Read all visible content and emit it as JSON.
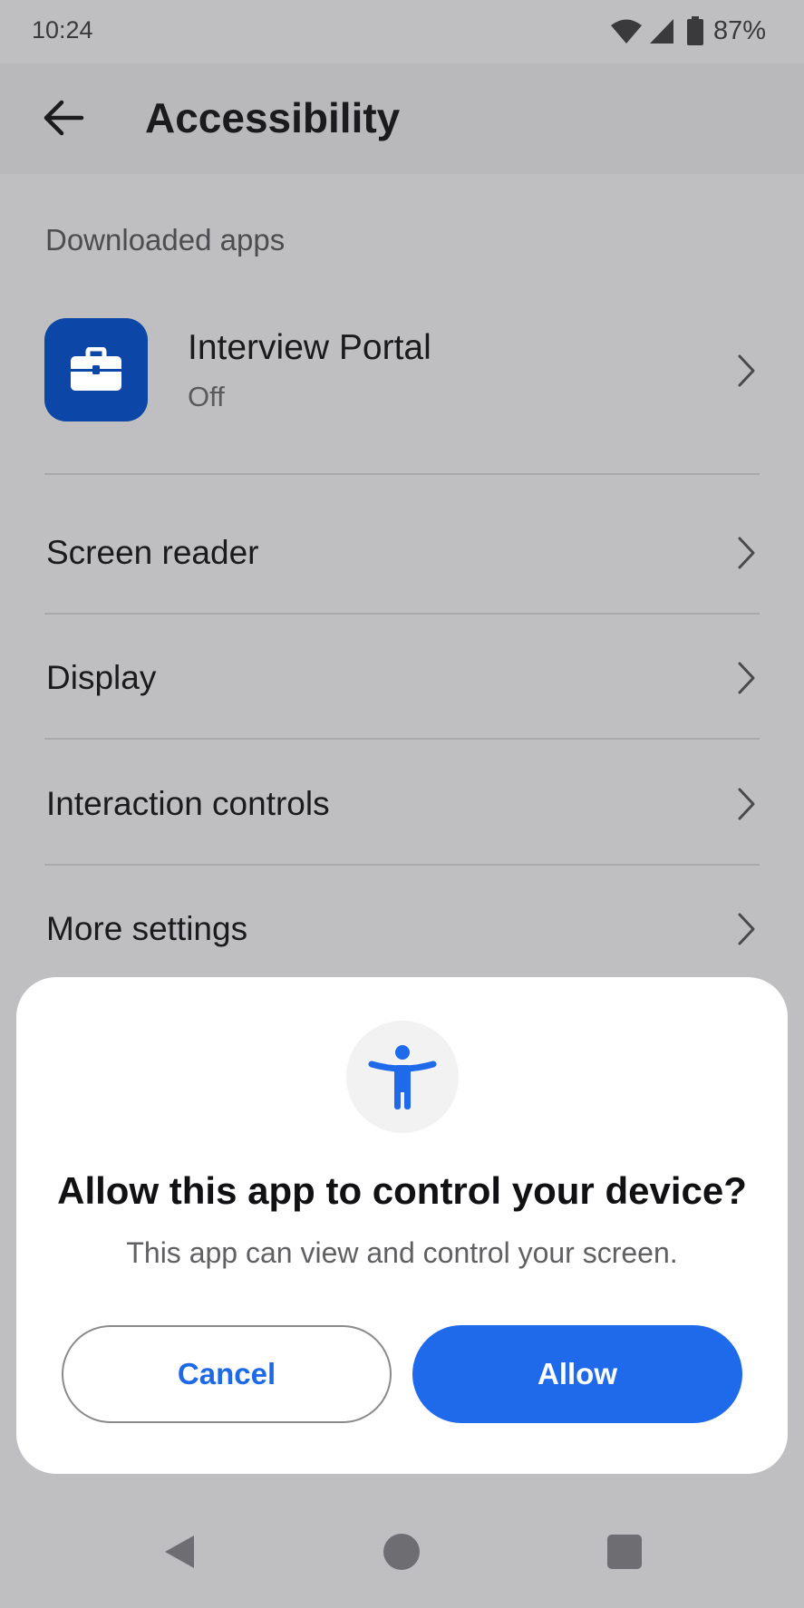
{
  "status_bar": {
    "time": "10:24",
    "battery_percent": "87%",
    "icons": [
      "wifi-icon",
      "cellular-signal-icon",
      "battery-icon"
    ]
  },
  "app_bar": {
    "title": "Accessibility",
    "back_icon": "arrow-left-icon"
  },
  "downloaded_apps": {
    "header": "Downloaded apps",
    "items": [
      {
        "name": "Interview Portal",
        "status": "Off",
        "icon": "briefcase-icon",
        "icon_bg": "#0c46a6"
      }
    ]
  },
  "menu": {
    "items": [
      {
        "label": "Screen reader"
      },
      {
        "label": "Display"
      },
      {
        "label": "Interaction controls"
      },
      {
        "label": "More settings"
      }
    ]
  },
  "dialog": {
    "icon": "accessibility-person-icon",
    "title": "Allow this app to control your device?",
    "message": "This app can view and control your screen.",
    "cancel_label": "Cancel",
    "allow_label": "Allow",
    "accent_color": "#1e6aeb"
  },
  "nav_bar": {
    "buttons": [
      "back-triangle-icon",
      "home-circle-icon",
      "recents-square-icon"
    ]
  }
}
